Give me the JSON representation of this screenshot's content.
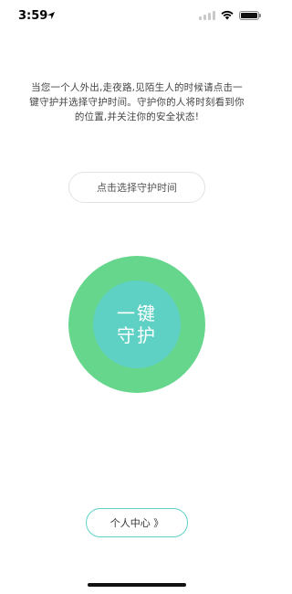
{
  "status_bar": {
    "time": "3:59",
    "icons": [
      "location-arrow-icon",
      "signal-icon",
      "wifi-icon",
      "battery-icon"
    ]
  },
  "description": "当您一个人外出,走夜路,见陌生人的时候请点击一键守护并选择守护时间。守护你的人将时刻看到你的位置,并关注你的安全状态!",
  "select_time_button": {
    "label": "点击选择守护时间"
  },
  "guard_button": {
    "line1": "一键",
    "line2": "守护"
  },
  "personal_center_button": {
    "label": "个人中心 》"
  },
  "colors": {
    "outer_circle": "#66d68c",
    "inner_circle": "#5fd1c4",
    "accent_border": "#5fd1c4"
  }
}
